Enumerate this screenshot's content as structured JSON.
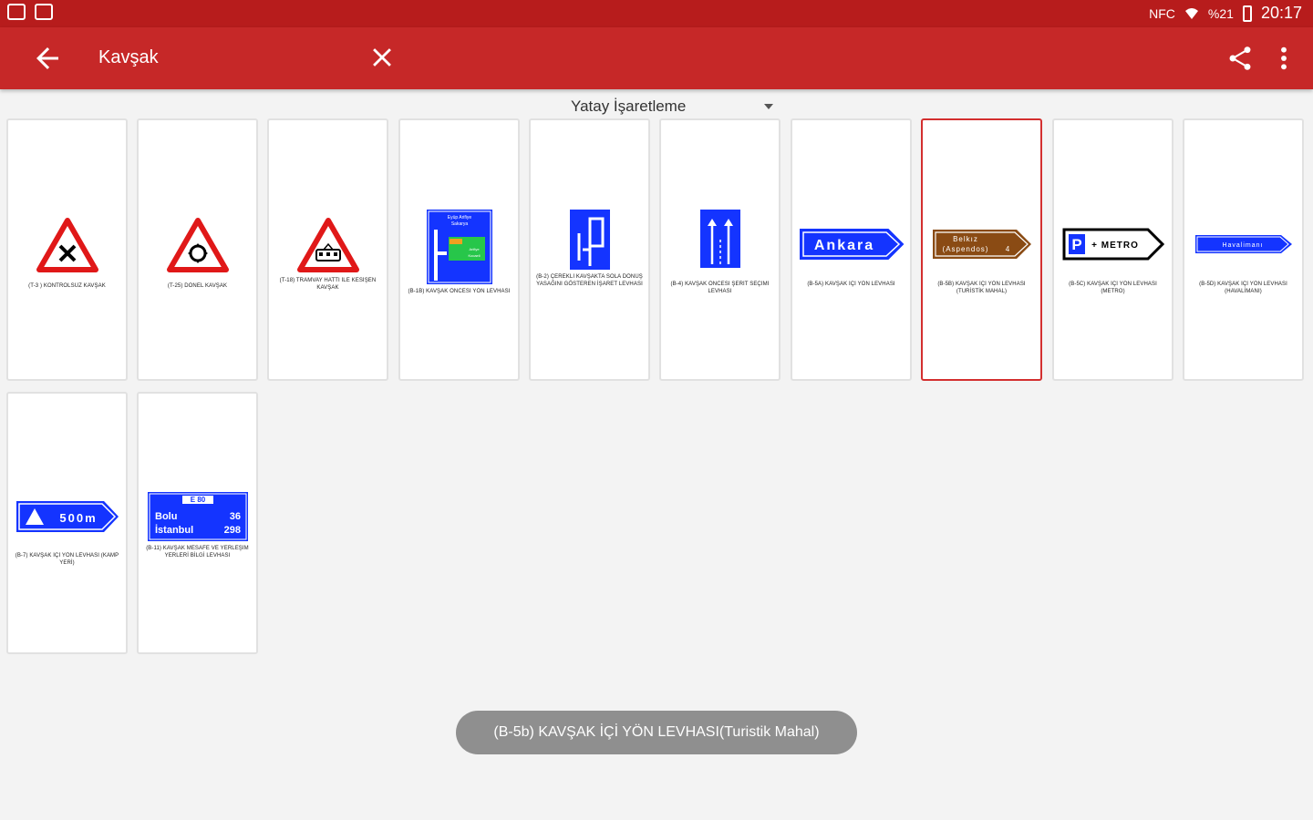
{
  "status_bar": {
    "network": "NFC",
    "battery": "%21",
    "time": "20:17"
  },
  "app_bar": {
    "title": "Kavşak"
  },
  "filter": {
    "selected": "Yatay İşaretleme"
  },
  "cards": [
    {
      "caption": "(T-3 ) KONTROLSÜZ KAVŞAK"
    },
    {
      "caption": "(T-25) DÖNEL KAVŞAK"
    },
    {
      "caption": "(T-18) TRAMVAY HATTI İLE KESİŞEN KAVŞAK"
    },
    {
      "caption": "(B-1b) KAVŞAK ÖNCESİ YÖN LEVHASI",
      "lines": [
        "Eyüp Arifiye",
        "Sakarya",
        "Arifiye",
        "Kocaeli"
      ]
    },
    {
      "caption": "(B-2) ÇEREKLİ KAVŞAKTA SOLA DÖNÜŞ YASAĞINI GÖSTEREN İŞARET LEVHASI"
    },
    {
      "caption": "(B-4) KAVŞAK ÖNCESİ ŞERİT SEÇİMİ LEVHASI"
    },
    {
      "caption": "(B-5a) KAVŞAK İÇİ YÖN LEVHASI",
      "lines": [
        "Ankara"
      ]
    },
    {
      "caption": "(B-5b) KAVŞAK İÇİ YÖN LEVHASI (TURİSTİK MAHAL)",
      "lines": [
        "Belkız",
        "(Aspendos)",
        "4"
      ]
    },
    {
      "caption": "(B-5c) KAVŞAK İÇİ YÖN LEVHASI (METRO)",
      "lines": [
        "P",
        "+ METRO"
      ]
    },
    {
      "caption": "(B-5d) KAVŞAK İÇİ YÖN LEVHASI (HAVALİMANI)",
      "lines": [
        "Havalimanı"
      ]
    },
    {
      "caption": "(B-7) KAVŞAK İÇİ YÖN LEVHASI (KAMP YERİ)",
      "lines": [
        "500m"
      ]
    },
    {
      "caption": "(B-11) KAVŞAK MESAFE VE YERLEŞİM YERLERİ BİLGİ LEVHASI",
      "lines": [
        "E 80",
        "Bolu",
        "36",
        "İstanbul",
        "298"
      ]
    }
  ],
  "toast": {
    "text": "(B-5b) KAVŞAK İÇİ YÖN LEVHASI(Turistik Mahal)"
  },
  "colors": {
    "status_bar": "#b71c1c",
    "app_bar": "#c62828",
    "selected_border": "#d32f2f",
    "sign_blue": "#1434ff",
    "sign_red": "#e01818",
    "sign_brown": "#8a4b14",
    "sign_green": "#27c64a"
  }
}
